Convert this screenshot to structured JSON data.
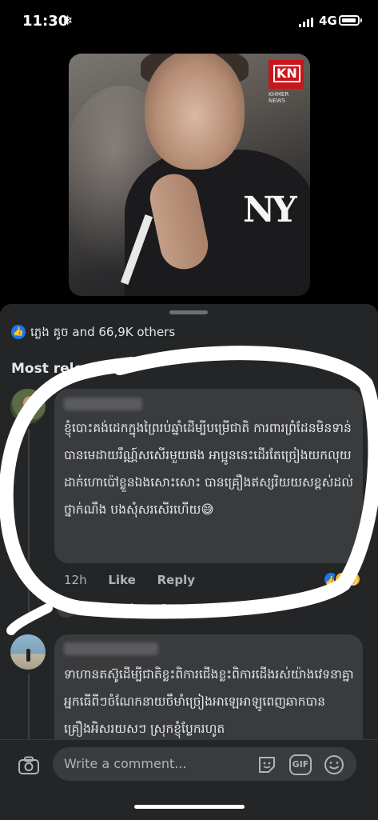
{
  "status_bar": {
    "time": "11:30",
    "weather_glyph": "❄",
    "network": "4G"
  },
  "post": {
    "logo_text": "KN",
    "logo_subtitle": "KHMER NEWS",
    "shirt_logo": "NY"
  },
  "reactions": {
    "text": "ភ្លេង គូច and 66,9K others"
  },
  "sort_label": "Most releva",
  "comments": [
    {
      "text": "ខ្ញុំបោះគង់ដេកក្នុងព្រៃរប់ឆ្នាំដើម្បីបម្រើជាតិ ការពារព្រំដែនមិនទាន់បានមេដាយរឹណ្ណ៍សសើរមួយផង អាប្អូននេះដើរតែច្រៀងយកលុយដាក់ហោប៉ៅខ្លួនឯងសោះសោះ បានគ្រឿងឥស្សរិយយសខ្ពស់ដល់ថ្នាក់ណឹង បងសុំសរសើរហើយ😅",
      "time": "12h",
      "like_label": "Like",
      "reply_label": "Reply",
      "reply_summary_name": "Borysokun Oren",
      "reply_summary_rest": " re…          replies"
    },
    {
      "text": "ទាហានតស៊ូដើម្បីជាតិខ្លះពិការជើងខ្លះពិការដើងរស់យ៉ាងវេទនាគ្នាអ្នកធើពីៗចំណែកនាយចឹមាំច្រៀងអាឡេអាឡូពេញឆាកបានគ្រឿងអិសរយសៗ ស្រុកខ្ញុំប្លែករហូត"
    }
  ],
  "composer": {
    "placeholder": "Write a comment...",
    "gif_label": "GIF"
  },
  "colors": {
    "background": "#000000",
    "sheet": "#242526",
    "bubble": "#3a3b3c",
    "like_blue": "#1877f2"
  }
}
